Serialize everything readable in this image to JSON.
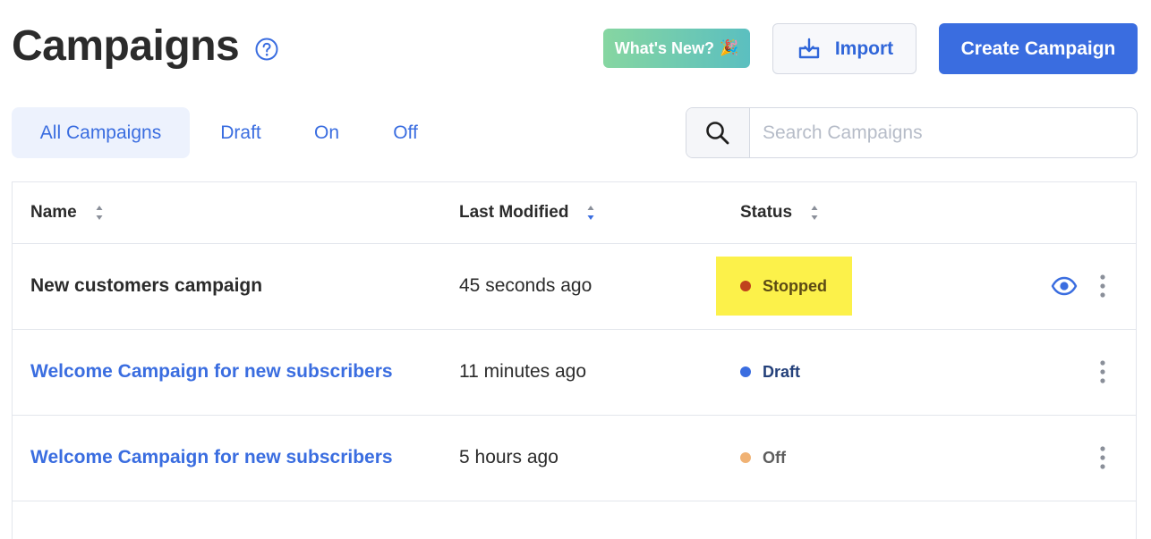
{
  "header": {
    "title": "Campaigns",
    "help_icon": "question-circle-icon",
    "whats_new_label": "What's New?",
    "whats_new_emoji": "🎉",
    "import_label": "Import",
    "import_icon": "import-tray-icon",
    "create_label": "Create Campaign"
  },
  "tabs": [
    {
      "label": "All Campaigns",
      "active": true
    },
    {
      "label": "Draft",
      "active": false
    },
    {
      "label": "On",
      "active": false
    },
    {
      "label": "Off",
      "active": false
    }
  ],
  "search": {
    "placeholder": "Search Campaigns",
    "value": "",
    "icon": "search-icon"
  },
  "table": {
    "columns": [
      {
        "label": "Name",
        "sort": "none"
      },
      {
        "label": "Last Modified",
        "sort": "desc"
      },
      {
        "label": "Status",
        "sort": "none"
      }
    ],
    "rows": [
      {
        "name": "New customers campaign",
        "name_style": "plain",
        "last_modified": "45 seconds ago",
        "status": "Stopped",
        "status_color": "#c0421d",
        "status_text_color": "#5b4a14",
        "highlighted": true,
        "has_preview": true
      },
      {
        "name": "Welcome Campaign for new subscribers",
        "name_style": "link",
        "last_modified": "11 minutes ago",
        "status": "Draft",
        "status_color": "#3a6de0",
        "status_text_color": "#24407a",
        "highlighted": false,
        "has_preview": false
      },
      {
        "name": "Welcome Campaign for new subscribers",
        "name_style": "link",
        "last_modified": "5 hours ago",
        "status": "Off",
        "status_color": "#f0b274",
        "status_text_color": "#5d5d5d",
        "highlighted": false,
        "has_preview": false
      }
    ]
  },
  "colors": {
    "accent": "#3a6de0",
    "highlight": "#fcf14a",
    "border": "#e3e6ec"
  }
}
